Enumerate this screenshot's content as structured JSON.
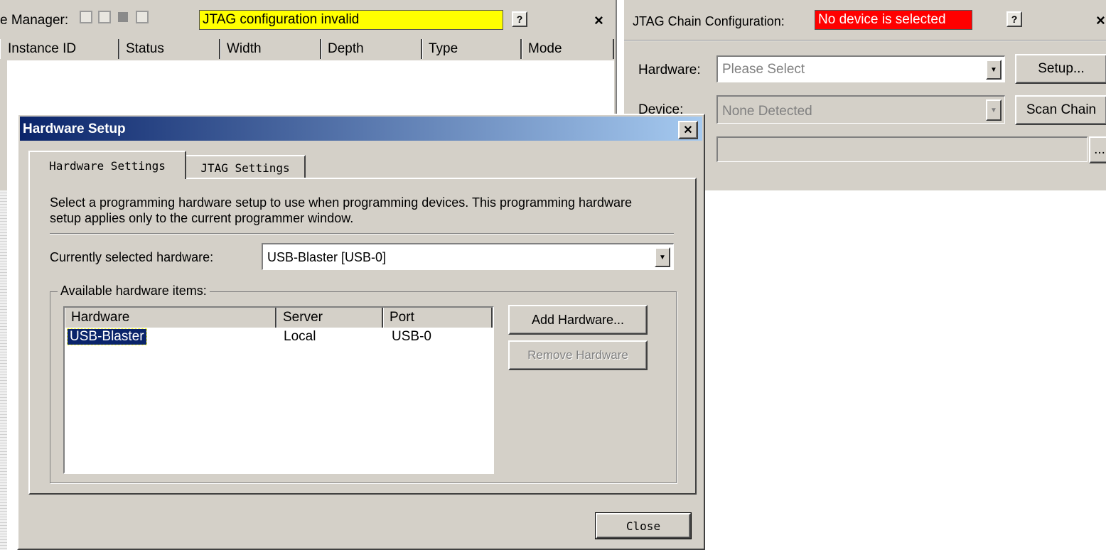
{
  "instance_manager": {
    "title": "e Manager:",
    "status_text": "JTAG configuration invalid",
    "status_color": "#ffff00",
    "help_icon": "help-icon",
    "close_icon": "close-icon",
    "columns": [
      "Instance ID",
      "Status",
      "Width",
      "Depth",
      "Type",
      "Mode"
    ]
  },
  "jtag_chain": {
    "title": "JTAG Chain Configuration:",
    "status_text": "No device is selected",
    "status_color": "#ff0000",
    "hardware_label": "Hardware:",
    "hardware_value": "Please Select",
    "setup_label": "Setup...",
    "device_label": "Device:",
    "device_value": "None Detected",
    "scan_chain_label": "Scan Chain",
    "browse_label": "..."
  },
  "dialog": {
    "title": "Hardware Setup",
    "title_gradient": [
      "#0a246a",
      "#a6caf0"
    ],
    "tabs": [
      "Hardware Settings",
      "JTAG Settings"
    ],
    "description": "Select a programming hardware setup to use when programming devices. This programming hardware setup applies only to the current programmer window.",
    "current_hw_label": "Currently selected hardware:",
    "current_hw_value": "USB-Blaster [USB-0]",
    "group_label": "Available hardware items:",
    "list_columns": [
      "Hardware",
      "Server",
      "Port"
    ],
    "list_rows": [
      {
        "hardware": "USB-Blaster",
        "server": "Local",
        "port": "USB-0"
      }
    ],
    "add_button": "Add Hardware...",
    "remove_button": "Remove Hardware",
    "close_button": "Close"
  }
}
